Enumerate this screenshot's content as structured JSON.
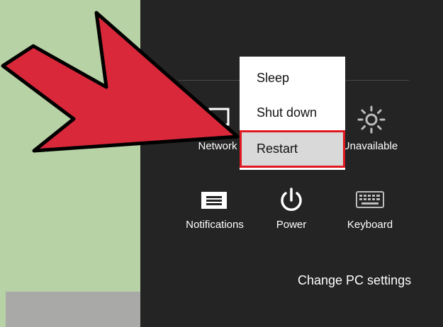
{
  "power_menu": {
    "items": [
      {
        "label": "Sleep"
      },
      {
        "label": "Shut down"
      },
      {
        "label": "Restart",
        "highlighted": true
      }
    ]
  },
  "quick_settings": {
    "network_label": "Network",
    "brightness_label": "Unavailable",
    "notifications_label": "Notifications",
    "power_label": "Power",
    "keyboard_label": "Keyboard"
  },
  "footer": {
    "change_pc_settings": "Change PC settings"
  },
  "colors": {
    "panel_bg": "#242424",
    "highlight_border": "#e0181f",
    "arrow_fill": "#d8283a",
    "desktop_bg": "#b7d2a4"
  },
  "icons": {
    "network": "network-icon",
    "brightness": "brightness-icon",
    "notifications": "notifications-icon",
    "power": "power-icon",
    "keyboard": "keyboard-icon",
    "pointer": "pointer-arrow-icon"
  }
}
